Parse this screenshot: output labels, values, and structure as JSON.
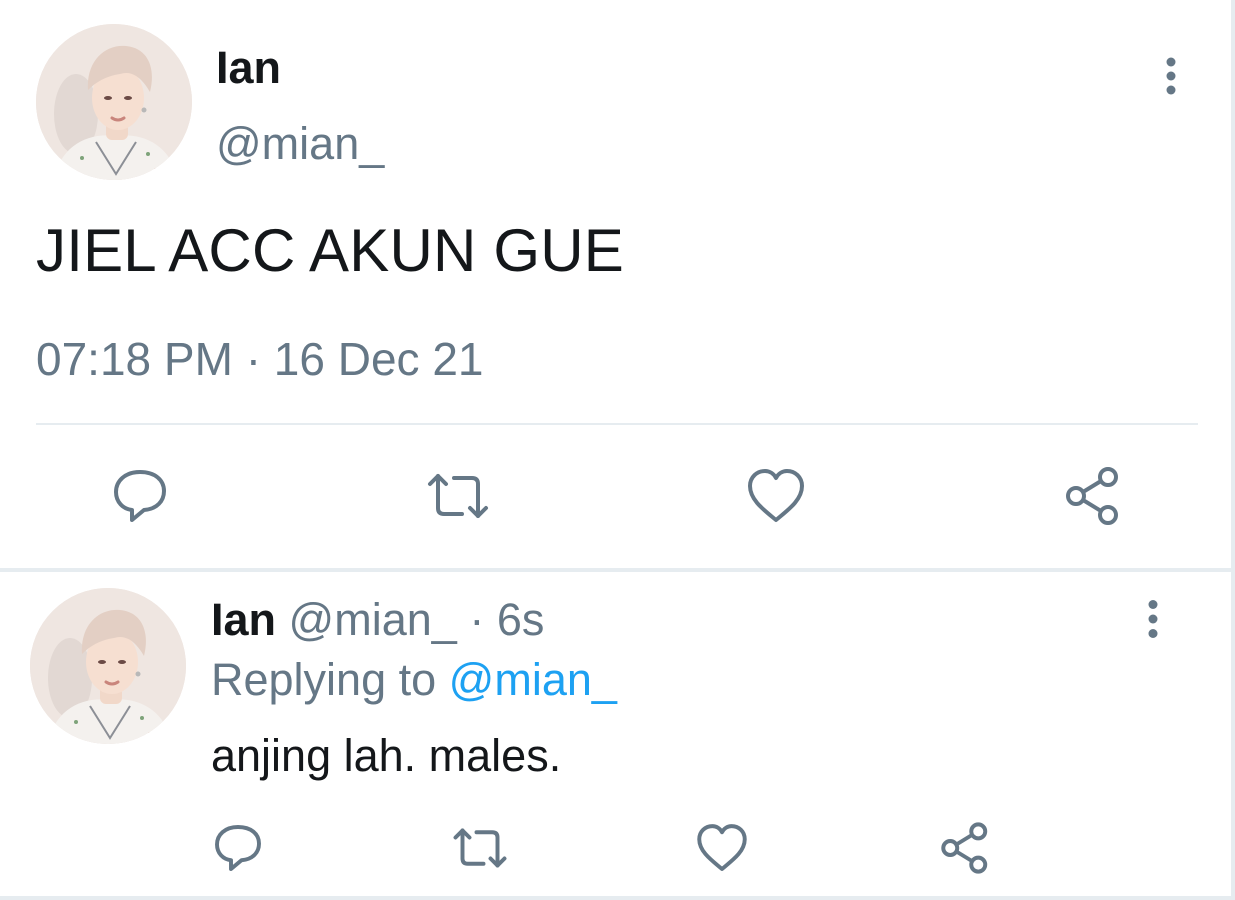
{
  "colors": {
    "primary_text": "#14171a",
    "secondary_text": "#657786",
    "link": "#1da1f2",
    "divider": "#e6ecf0",
    "icon": "#657786"
  },
  "main_tweet": {
    "avatar_icon": "user-avatar-photo",
    "name": "Ian",
    "handle": "@mian_",
    "text": "JIEL ACC AKUN GUE",
    "time": "07:18 PM",
    "separator": "·",
    "date": "16 Dec 21",
    "more_icon": "vertical-dots-icon",
    "actions": [
      {
        "name": "reply",
        "icon": "reply-bubble-icon"
      },
      {
        "name": "retweet",
        "icon": "retweet-icon"
      },
      {
        "name": "like",
        "icon": "heart-icon"
      },
      {
        "name": "share",
        "icon": "share-icon"
      }
    ]
  },
  "reply_tweet": {
    "avatar_icon": "user-avatar-photo",
    "name": "Ian",
    "handle": "@mian_",
    "separator": "·",
    "age": "6s",
    "replying_prefix": "Replying to",
    "replying_to": "@mian_",
    "text": "anjing lah. males.",
    "more_icon": "vertical-dots-icon",
    "actions": [
      {
        "name": "reply",
        "icon": "reply-bubble-icon"
      },
      {
        "name": "retweet",
        "icon": "retweet-icon"
      },
      {
        "name": "like",
        "icon": "heart-icon"
      },
      {
        "name": "share",
        "icon": "share-icon"
      }
    ]
  }
}
